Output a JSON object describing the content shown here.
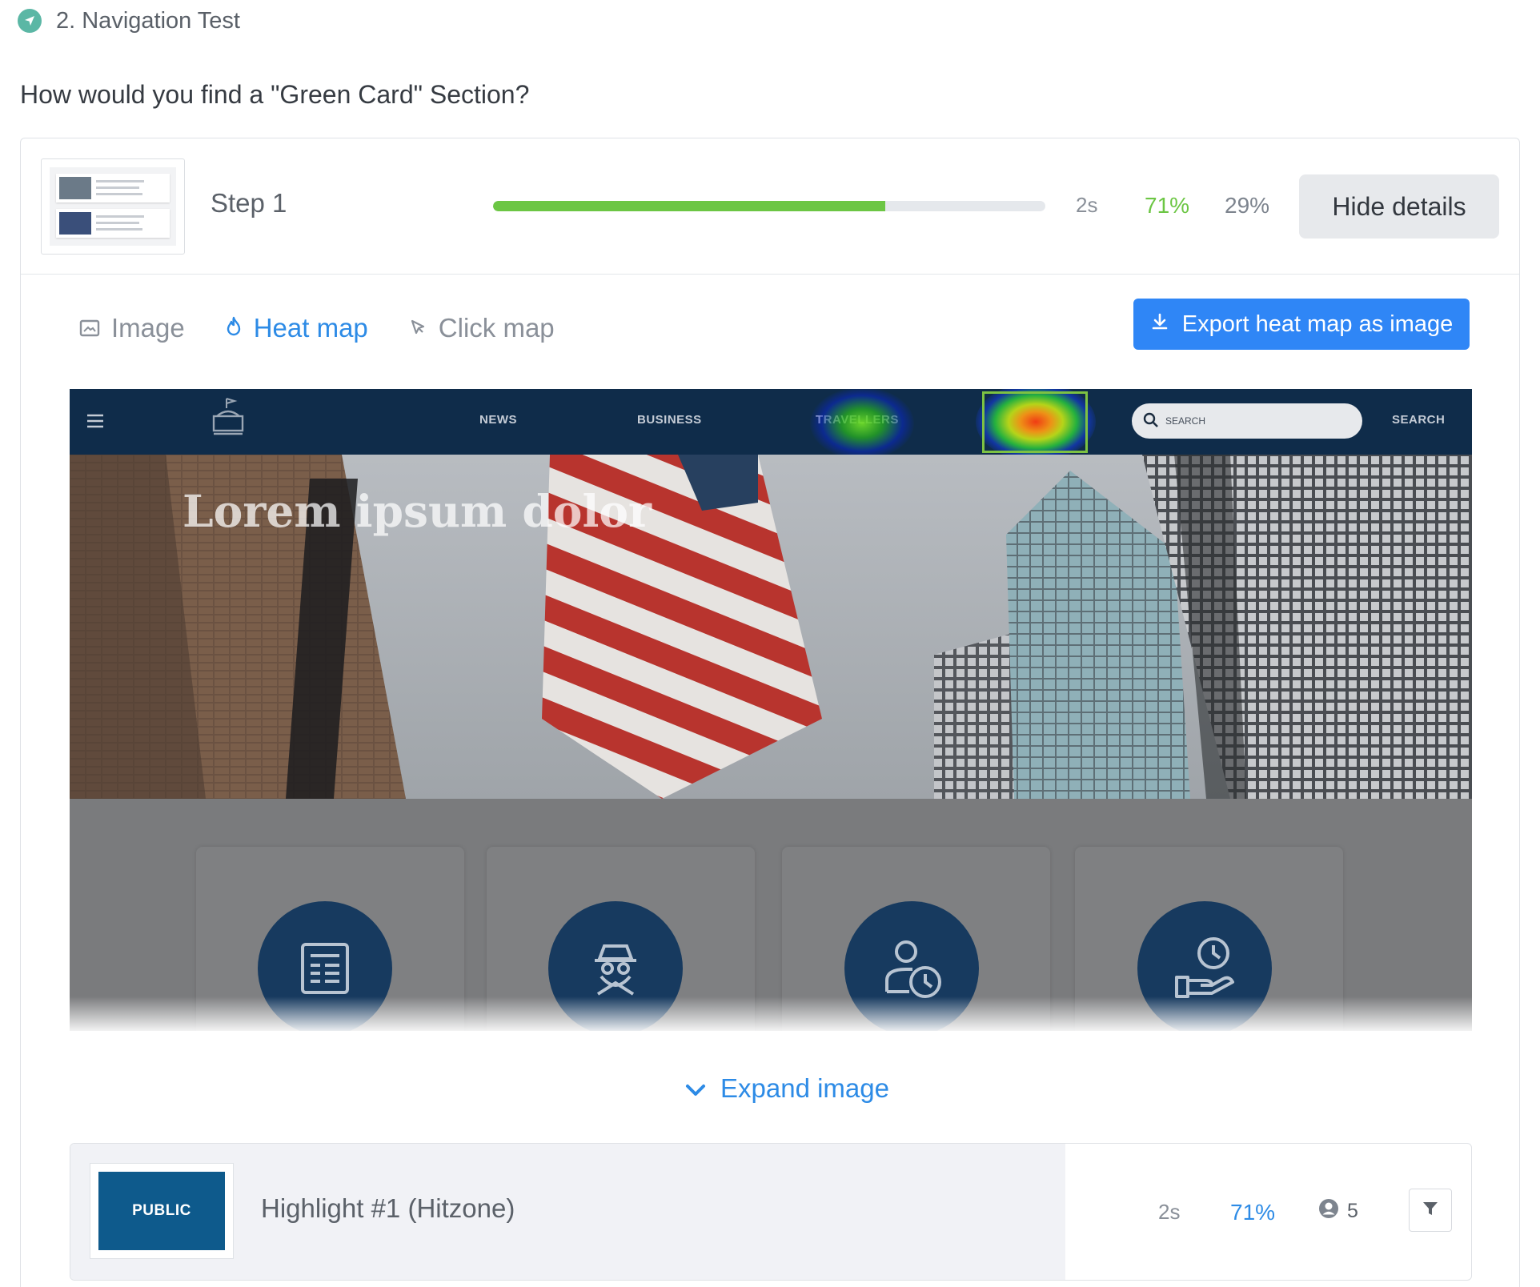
{
  "test": {
    "title": "2. Navigation Test",
    "icon": "navigation-arrow-icon"
  },
  "question": "How would you find a \"Green Card\" Section?",
  "step": {
    "label": "Step 1",
    "progress_success_fraction": 0.71,
    "time": "2s",
    "success_pct": "71%",
    "fail_pct": "29%",
    "hide_label": "Hide details"
  },
  "tabs": [
    {
      "label": "Image",
      "icon": "image-icon",
      "active": false
    },
    {
      "label": "Heat map",
      "icon": "flame-icon",
      "active": true
    },
    {
      "label": "Click map",
      "icon": "cursor-click-icon",
      "active": false
    }
  ],
  "export_label": "Export heat map as image",
  "screenshot": {
    "nav_links": [
      "NEWS",
      "BUSINESS",
      "TRAVELLERS",
      "SEARCH"
    ],
    "search_placeholder": "SEARCH",
    "hero_title": "Lorem ipsum dolor",
    "card_icons": [
      "document-icon",
      "spy-icon",
      "user-clock-icon",
      "hand-clock-icon"
    ]
  },
  "expand_label": "Expand image",
  "highlight": {
    "thumb_text": "PUBLIC",
    "title": "Highlight #1 (Hitzone)",
    "time": "2s",
    "pct": "71%",
    "users": "5"
  },
  "colors": {
    "accent_blue": "#2d8be6",
    "success_green": "#6cc644",
    "site_navy": "#0f2c4a",
    "hitzone_border": "#7dc242"
  }
}
